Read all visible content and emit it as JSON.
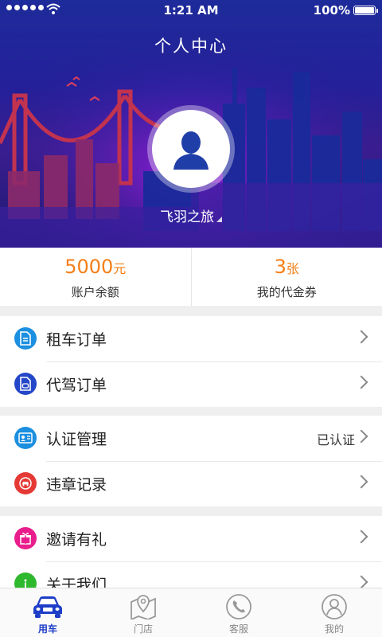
{
  "status_bar": {
    "time": "1:21 AM",
    "battery": "100%"
  },
  "header": {
    "title": "个人中心",
    "username": "飞羽之旅"
  },
  "stats": [
    {
      "value": "5000",
      "unit": "元",
      "label": "账户余额"
    },
    {
      "value": "3",
      "unit": "张",
      "label": "我的代金券"
    }
  ],
  "menu": {
    "rental_orders": "租车订单",
    "driver_orders": "代驾订单",
    "verification": "认证管理",
    "verification_status": "已认证",
    "violations": "违章记录",
    "invite": "邀请有礼",
    "about": "关于我们"
  },
  "tabs": [
    "用车",
    "门店",
    "客服",
    "我的"
  ],
  "colors": {
    "accent": "#f57f17",
    "tab_active": "#1e3ec8",
    "icon_blue": "#1b8fe0",
    "icon_dark_blue": "#2446c8",
    "icon_red": "#e53935",
    "icon_pink": "#e91e8c",
    "icon_green": "#2eb82e"
  }
}
